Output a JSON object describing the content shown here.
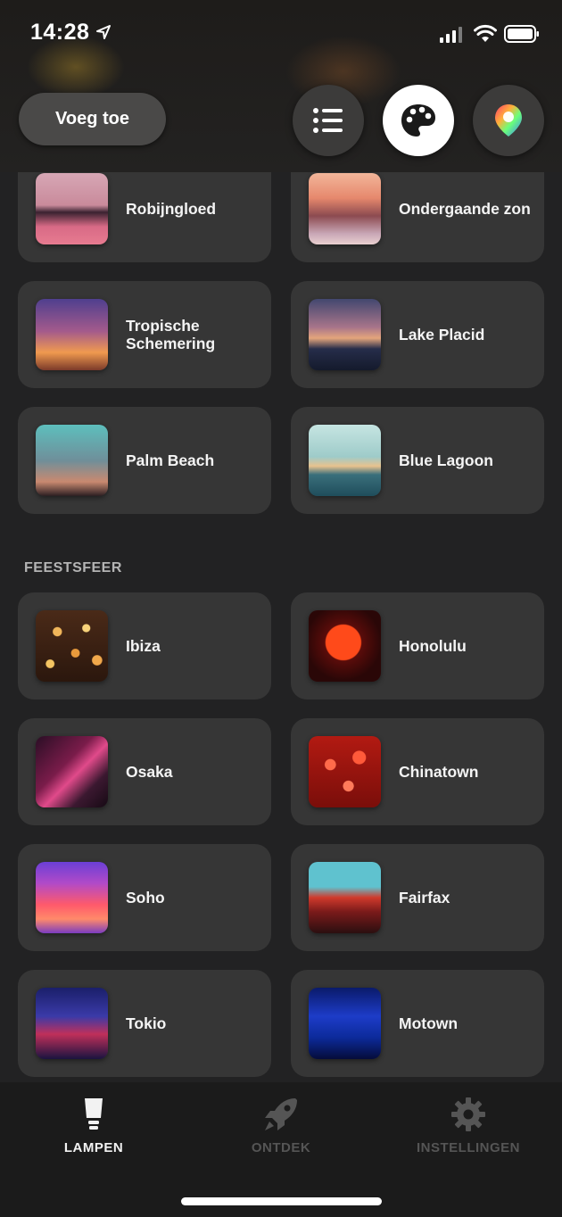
{
  "status_bar": {
    "time": "14:28"
  },
  "header": {
    "add_label": "Voeg toe"
  },
  "scenes_top": [
    {
      "label": "Robijngloed",
      "thumb": "t-robijn"
    },
    {
      "label": "Ondergaande zon",
      "thumb": "t-onder"
    },
    {
      "label": "Tropische Schemering",
      "thumb": "t-trop"
    },
    {
      "label": "Lake Placid",
      "thumb": "t-lake"
    },
    {
      "label": "Palm Beach",
      "thumb": "t-palm"
    },
    {
      "label": "Blue Lagoon",
      "thumb": "t-lagoon"
    }
  ],
  "section_feestsfeer": {
    "title": "FEESTSFEER"
  },
  "scenes_feest": [
    {
      "label": "Ibiza",
      "thumb": "t-ibiza"
    },
    {
      "label": "Honolulu",
      "thumb": "t-hono"
    },
    {
      "label": "Osaka",
      "thumb": "t-osaka"
    },
    {
      "label": "Chinatown",
      "thumb": "t-china"
    },
    {
      "label": "Soho",
      "thumb": "t-soho"
    },
    {
      "label": "Fairfax",
      "thumb": "t-fairfax"
    },
    {
      "label": "Tokio",
      "thumb": "t-tokio"
    },
    {
      "label": "Motown",
      "thumb": "t-motown"
    }
  ],
  "bottom_nav": {
    "lampen": "LAMPEN",
    "ontdek": "ONTDEK",
    "instellingen": "INSTELLINGEN",
    "active": "lampen"
  },
  "colors": {
    "background": "#222223",
    "card": "#363636",
    "accent": "#ffffff"
  }
}
